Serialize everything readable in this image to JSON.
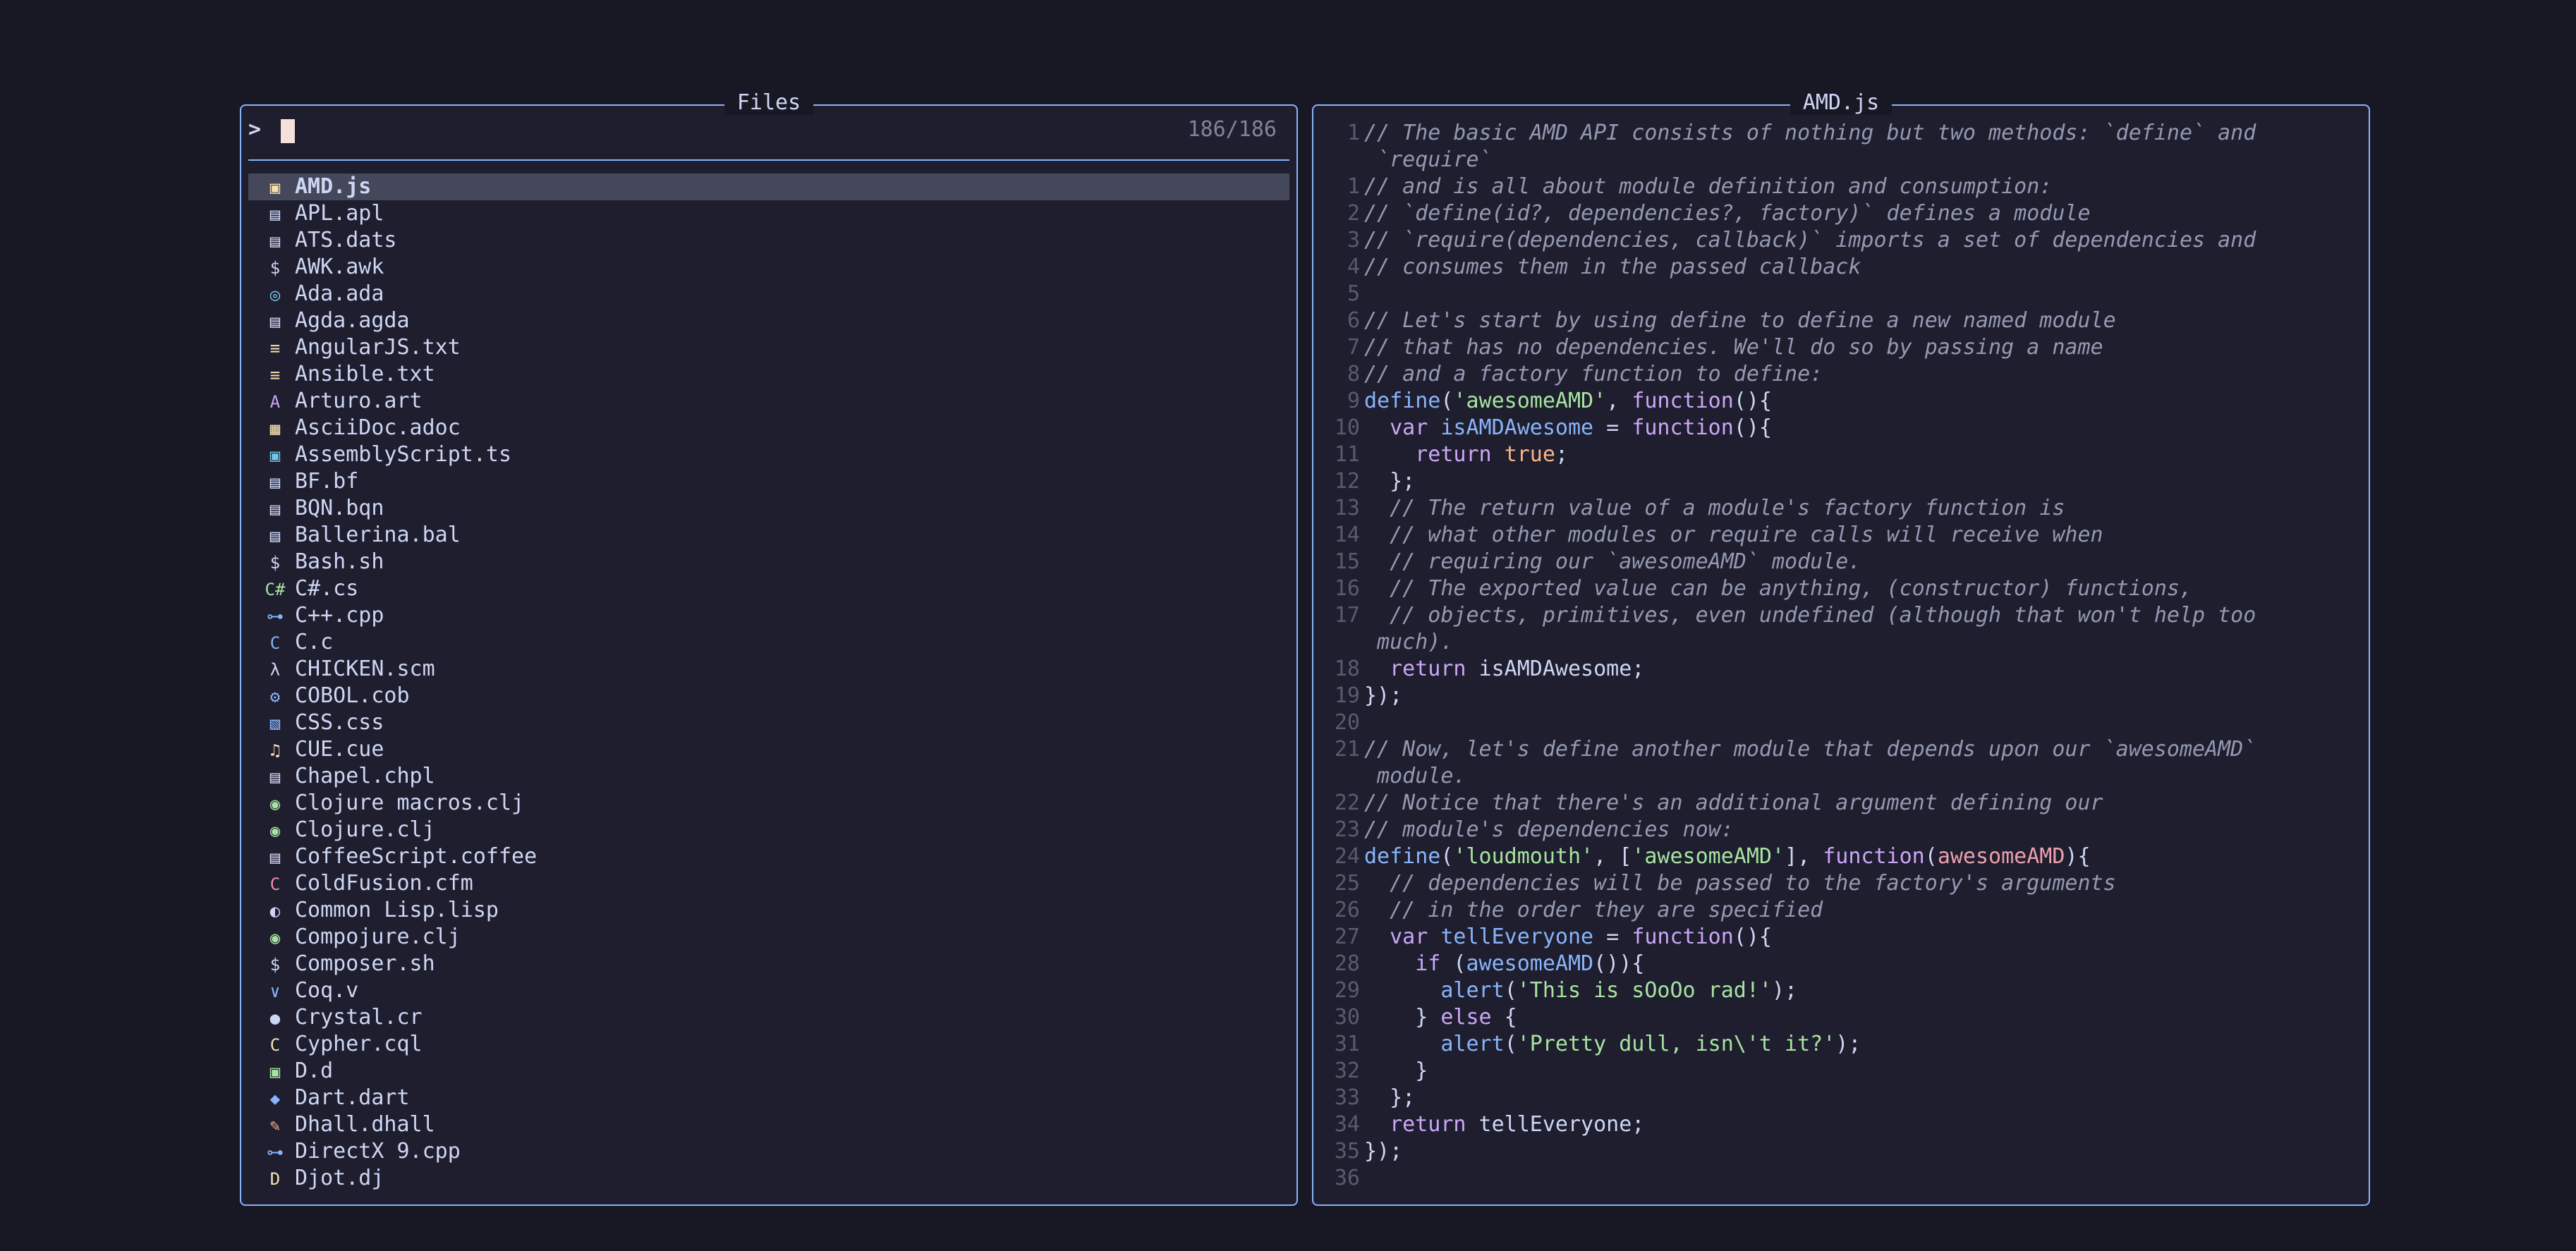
{
  "files_pane": {
    "title": "Files",
    "prompt_symbol": ">",
    "match_count": "186/186",
    "files": [
      {
        "name": "AMD.js",
        "icon": "js-file-icon",
        "glyph": "▣",
        "color": "#f9e2af",
        "selected": true
      },
      {
        "name": "APL.apl",
        "icon": "file-icon",
        "glyph": "▤",
        "color": "#cdd6f4"
      },
      {
        "name": "ATS.dats",
        "icon": "file-icon",
        "glyph": "▤",
        "color": "#cdd6f4"
      },
      {
        "name": "AWK.awk",
        "icon": "shell-icon",
        "glyph": "$",
        "color": "#cdd6f4"
      },
      {
        "name": "Ada.ada",
        "icon": "ada-icon",
        "glyph": "◎",
        "color": "#74c7ec"
      },
      {
        "name": "Agda.agda",
        "icon": "file-icon",
        "glyph": "▤",
        "color": "#cdd6f4"
      },
      {
        "name": "AngularJS.txt",
        "icon": "text-file-icon",
        "glyph": "≡",
        "color": "#f9e2af"
      },
      {
        "name": "Ansible.txt",
        "icon": "text-file-icon",
        "glyph": "≡",
        "color": "#f9e2af"
      },
      {
        "name": "Arturo.art",
        "icon": "arturo-icon",
        "glyph": "A",
        "color": "#cba6f7"
      },
      {
        "name": "AsciiDoc.adoc",
        "icon": "asciidoc-icon",
        "glyph": "▦",
        "color": "#f9e2af"
      },
      {
        "name": "AssemblyScript.ts",
        "icon": "typescript-icon",
        "glyph": "▣",
        "color": "#74c7ec"
      },
      {
        "name": "BF.bf",
        "icon": "file-icon",
        "glyph": "▤",
        "color": "#cdd6f4"
      },
      {
        "name": "BQN.bqn",
        "icon": "file-icon",
        "glyph": "▤",
        "color": "#cdd6f4"
      },
      {
        "name": "Ballerina.bal",
        "icon": "file-icon",
        "glyph": "▤",
        "color": "#cdd6f4"
      },
      {
        "name": "Bash.sh",
        "icon": "shell-icon",
        "glyph": "$",
        "color": "#cdd6f4"
      },
      {
        "name": "C#.cs",
        "icon": "csharp-icon",
        "glyph": "C#",
        "color": "#a6e3a1"
      },
      {
        "name": "C++.cpp",
        "icon": "cpp-icon",
        "glyph": "⊶",
        "color": "#89b4fa"
      },
      {
        "name": "C.c",
        "icon": "c-icon",
        "glyph": "C",
        "color": "#89b4fa"
      },
      {
        "name": "CHICKEN.scm",
        "icon": "lambda-icon",
        "glyph": "λ",
        "color": "#cdd6f4"
      },
      {
        "name": "COBOL.cob",
        "icon": "cobol-icon",
        "glyph": "⚙",
        "color": "#89b4fa"
      },
      {
        "name": "CSS.css",
        "icon": "css-icon",
        "glyph": "▧",
        "color": "#89b4fa"
      },
      {
        "name": "CUE.cue",
        "icon": "music-note-icon",
        "glyph": "♫",
        "color": "#f9e2af"
      },
      {
        "name": "Chapel.chpl",
        "icon": "file-icon",
        "glyph": "▤",
        "color": "#cdd6f4"
      },
      {
        "name": "Clojure macros.clj",
        "icon": "clojure-icon",
        "glyph": "◉",
        "color": "#a6e3a1"
      },
      {
        "name": "Clojure.clj",
        "icon": "clojure-icon",
        "glyph": "◉",
        "color": "#a6e3a1"
      },
      {
        "name": "CoffeeScript.coffee",
        "icon": "file-icon",
        "glyph": "▤",
        "color": "#cdd6f4"
      },
      {
        "name": "ColdFusion.cfm",
        "icon": "coldfusion-icon",
        "glyph": "C",
        "color": "#f38ba8"
      },
      {
        "name": "Common Lisp.lisp",
        "icon": "lisp-icon",
        "glyph": "◐",
        "color": "#cdd6f4"
      },
      {
        "name": "Compojure.clj",
        "icon": "clojure-icon",
        "glyph": "◉",
        "color": "#a6e3a1"
      },
      {
        "name": "Composer.sh",
        "icon": "shell-icon",
        "glyph": "$",
        "color": "#cdd6f4"
      },
      {
        "name": "Coq.v",
        "icon": "coq-icon",
        "glyph": "∨",
        "color": "#89b4fa"
      },
      {
        "name": "Crystal.cr",
        "icon": "crystal-icon",
        "glyph": "●",
        "color": "#cdd6f4"
      },
      {
        "name": "Cypher.cql",
        "icon": "cypher-icon",
        "glyph": "C",
        "color": "#f9e2af"
      },
      {
        "name": "D.d",
        "icon": "d-lang-icon",
        "glyph": "▣",
        "color": "#a6e3a1"
      },
      {
        "name": "Dart.dart",
        "icon": "dart-icon",
        "glyph": "◆",
        "color": "#89b4fa"
      },
      {
        "name": "Dhall.dhall",
        "icon": "dhall-icon",
        "glyph": "✎",
        "color": "#fab387"
      },
      {
        "name": "DirectX 9.cpp",
        "icon": "cpp-icon",
        "glyph": "⊶",
        "color": "#89b4fa"
      },
      {
        "name": "Djot.dj",
        "icon": "djot-icon",
        "glyph": "D",
        "color": "#f9e2af"
      }
    ]
  },
  "preview_pane": {
    "title": "AMD.js",
    "lines": [
      {
        "ln": "1",
        "tokens": [
          {
            "c": "cmt",
            "t": "// The basic AMD API consists of nothing but two methods: `define` and"
          }
        ]
      },
      {
        "ln": "",
        "tokens": [
          {
            "c": "cmt",
            "t": " `require`"
          }
        ]
      },
      {
        "ln": "1",
        "tokens": [
          {
            "c": "cmt",
            "t": "// and is all about module definition and consumption:"
          }
        ]
      },
      {
        "ln": "2",
        "tokens": [
          {
            "c": "cmt",
            "t": "// `define(id?, dependencies?, factory)` defines a module"
          }
        ]
      },
      {
        "ln": "3",
        "tokens": [
          {
            "c": "cmt",
            "t": "// `require(dependencies, callback)` imports a set of dependencies and"
          }
        ]
      },
      {
        "ln": "4",
        "tokens": [
          {
            "c": "cmt",
            "t": "// consumes them in the passed callback"
          }
        ]
      },
      {
        "ln": "5",
        "tokens": []
      },
      {
        "ln": "6",
        "tokens": [
          {
            "c": "cmt",
            "t": "// Let's start by using define to define a new named module"
          }
        ]
      },
      {
        "ln": "7",
        "tokens": [
          {
            "c": "cmt",
            "t": "// that has no dependencies. We'll do so by passing a name"
          }
        ]
      },
      {
        "ln": "8",
        "tokens": [
          {
            "c": "cmt",
            "t": "// and a factory function to define:"
          }
        ]
      },
      {
        "ln": "9",
        "tokens": [
          {
            "c": "fn",
            "t": "define"
          },
          {
            "c": "code",
            "t": "("
          },
          {
            "c": "str",
            "t": "'awesomeAMD'"
          },
          {
            "c": "code",
            "t": ", "
          },
          {
            "c": "kw",
            "t": "function"
          },
          {
            "c": "code",
            "t": "(){"
          }
        ]
      },
      {
        "ln": "10",
        "tokens": [
          {
            "c": "code",
            "t": "  "
          },
          {
            "c": "kw",
            "t": "var"
          },
          {
            "c": "code",
            "t": " "
          },
          {
            "c": "fn",
            "t": "isAMDAwesome"
          },
          {
            "c": "code",
            "t": " = "
          },
          {
            "c": "kw",
            "t": "function"
          },
          {
            "c": "code",
            "t": "(){"
          }
        ]
      },
      {
        "ln": "11",
        "tokens": [
          {
            "c": "code",
            "t": "    "
          },
          {
            "c": "kw",
            "t": "return"
          },
          {
            "c": "code",
            "t": " "
          },
          {
            "c": "bool",
            "t": "true"
          },
          {
            "c": "code",
            "t": ";"
          }
        ]
      },
      {
        "ln": "12",
        "tokens": [
          {
            "c": "code",
            "t": "  };"
          }
        ]
      },
      {
        "ln": "13",
        "tokens": [
          {
            "c": "code",
            "t": "  "
          },
          {
            "c": "cmt",
            "t": "// The return value of a module's factory function is"
          }
        ]
      },
      {
        "ln": "14",
        "tokens": [
          {
            "c": "code",
            "t": "  "
          },
          {
            "c": "cmt",
            "t": "// what other modules or require calls will receive when"
          }
        ]
      },
      {
        "ln": "15",
        "tokens": [
          {
            "c": "code",
            "t": "  "
          },
          {
            "c": "cmt",
            "t": "// requiring our `awesomeAMD` module."
          }
        ]
      },
      {
        "ln": "16",
        "tokens": [
          {
            "c": "code",
            "t": "  "
          },
          {
            "c": "cmt",
            "t": "// The exported value can be anything, (constructor) functions,"
          }
        ]
      },
      {
        "ln": "17",
        "tokens": [
          {
            "c": "code",
            "t": "  "
          },
          {
            "c": "cmt",
            "t": "// objects, primitives, even undefined (although that won't help too"
          }
        ]
      },
      {
        "ln": "",
        "tokens": [
          {
            "c": "cmt",
            "t": " much)."
          }
        ]
      },
      {
        "ln": "18",
        "tokens": [
          {
            "c": "code",
            "t": "  "
          },
          {
            "c": "kw",
            "t": "return"
          },
          {
            "c": "code",
            "t": " isAMDAwesome;"
          }
        ]
      },
      {
        "ln": "19",
        "tokens": [
          {
            "c": "code",
            "t": "});"
          }
        ]
      },
      {
        "ln": "20",
        "tokens": []
      },
      {
        "ln": "21",
        "tokens": [
          {
            "c": "cmt",
            "t": "// Now, let's define another module that depends upon our `awesomeAMD`"
          }
        ]
      },
      {
        "ln": "",
        "tokens": [
          {
            "c": "cmt",
            "t": " module."
          }
        ]
      },
      {
        "ln": "22",
        "tokens": [
          {
            "c": "cmt",
            "t": "// Notice that there's an additional argument defining our"
          }
        ]
      },
      {
        "ln": "23",
        "tokens": [
          {
            "c": "cmt",
            "t": "// module's dependencies now:"
          }
        ]
      },
      {
        "ln": "24",
        "tokens": [
          {
            "c": "fn",
            "t": "define"
          },
          {
            "c": "code",
            "t": "("
          },
          {
            "c": "str",
            "t": "'loudmouth'"
          },
          {
            "c": "code",
            "t": ", ["
          },
          {
            "c": "str",
            "t": "'awesomeAMD'"
          },
          {
            "c": "code",
            "t": "], "
          },
          {
            "c": "kw",
            "t": "function"
          },
          {
            "c": "code",
            "t": "("
          },
          {
            "c": "param",
            "t": "awesomeAMD"
          },
          {
            "c": "code",
            "t": "){"
          }
        ]
      },
      {
        "ln": "25",
        "tokens": [
          {
            "c": "code",
            "t": "  "
          },
          {
            "c": "cmt",
            "t": "// dependencies will be passed to the factory's arguments"
          }
        ]
      },
      {
        "ln": "26",
        "tokens": [
          {
            "c": "code",
            "t": "  "
          },
          {
            "c": "cmt",
            "t": "// in the order they are specified"
          }
        ]
      },
      {
        "ln": "27",
        "tokens": [
          {
            "c": "code",
            "t": "  "
          },
          {
            "c": "kw",
            "t": "var"
          },
          {
            "c": "code",
            "t": " "
          },
          {
            "c": "fn",
            "t": "tellEveryone"
          },
          {
            "c": "code",
            "t": " = "
          },
          {
            "c": "kw",
            "t": "function"
          },
          {
            "c": "code",
            "t": "(){"
          }
        ]
      },
      {
        "ln": "28",
        "tokens": [
          {
            "c": "code",
            "t": "    "
          },
          {
            "c": "kw",
            "t": "if"
          },
          {
            "c": "code",
            "t": " ("
          },
          {
            "c": "fn",
            "t": "awesomeAMD"
          },
          {
            "c": "code",
            "t": "()){"
          }
        ]
      },
      {
        "ln": "29",
        "tokens": [
          {
            "c": "code",
            "t": "      "
          },
          {
            "c": "fn",
            "t": "alert"
          },
          {
            "c": "code",
            "t": "("
          },
          {
            "c": "str",
            "t": "'This is sOoOo rad!'"
          },
          {
            "c": "code",
            "t": ");"
          }
        ]
      },
      {
        "ln": "30",
        "tokens": [
          {
            "c": "code",
            "t": "    } "
          },
          {
            "c": "kw",
            "t": "else"
          },
          {
            "c": "code",
            "t": " {"
          }
        ]
      },
      {
        "ln": "31",
        "tokens": [
          {
            "c": "code",
            "t": "      "
          },
          {
            "c": "fn",
            "t": "alert"
          },
          {
            "c": "code",
            "t": "("
          },
          {
            "c": "str",
            "t": "'Pretty dull, isn\\'t it?'"
          },
          {
            "c": "code",
            "t": ");"
          }
        ]
      },
      {
        "ln": "32",
        "tokens": [
          {
            "c": "code",
            "t": "    }"
          }
        ]
      },
      {
        "ln": "33",
        "tokens": [
          {
            "c": "code",
            "t": "  };"
          }
        ]
      },
      {
        "ln": "34",
        "tokens": [
          {
            "c": "code",
            "t": "  "
          },
          {
            "c": "kw",
            "t": "return"
          },
          {
            "c": "code",
            "t": " tellEveryone;"
          }
        ]
      },
      {
        "ln": "35",
        "tokens": [
          {
            "c": "code",
            "t": "});"
          }
        ]
      },
      {
        "ln": "36",
        "tokens": []
      }
    ]
  }
}
